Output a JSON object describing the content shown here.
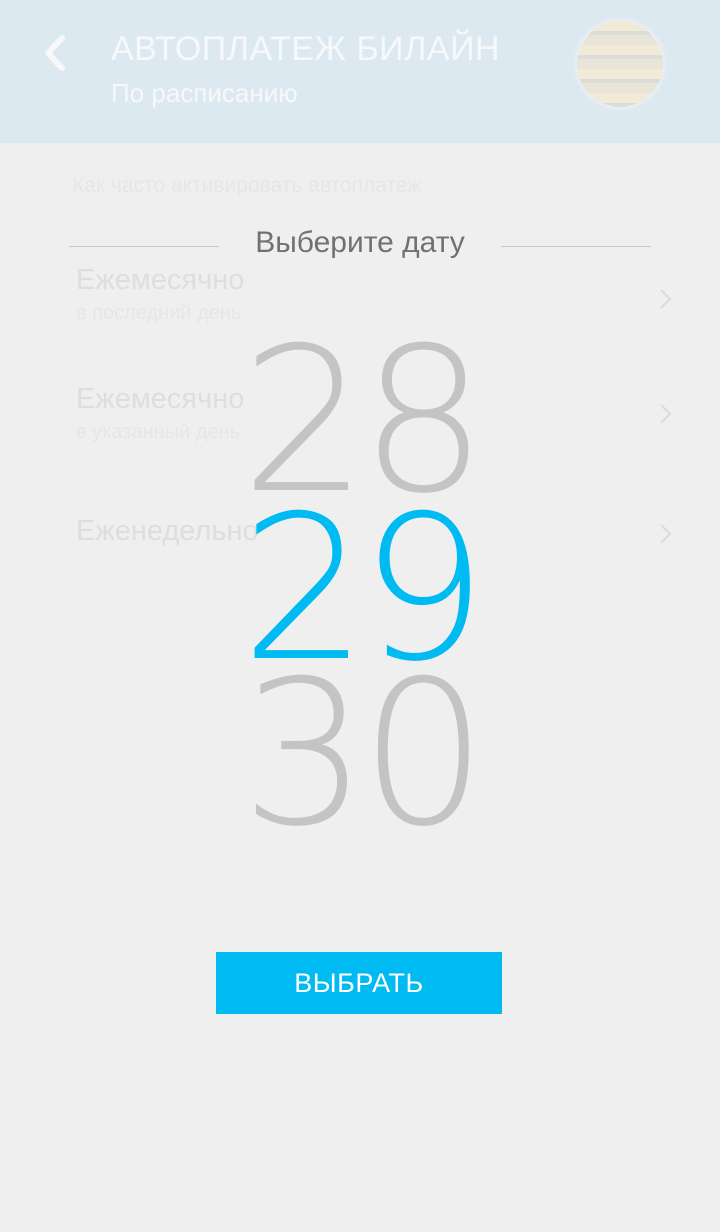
{
  "header": {
    "title": "АВТОПЛАТЕЖ БИЛАЙН",
    "subtitle": "По расписанию",
    "back_icon": "chevron-left-icon",
    "avatar": "beeline-logo"
  },
  "schedule": {
    "question": "Как часто активировать автоплатеж",
    "options": [
      {
        "title": "Ежемесячно",
        "subtitle": "в последний день"
      },
      {
        "title": "Ежемесячно",
        "subtitle": "в указанный день"
      },
      {
        "title": "Еженедельно",
        "subtitle": ""
      }
    ]
  },
  "picker": {
    "title": "Выберите дату",
    "previous_day": "28",
    "selected_day": "29",
    "next_day": "30",
    "button_label": "ВЫБРАТЬ"
  },
  "colors": {
    "accent": "#00baf2",
    "header_bg": "#dde9f1",
    "background": "#efefef",
    "inactive_number": "#c4c4c4"
  }
}
